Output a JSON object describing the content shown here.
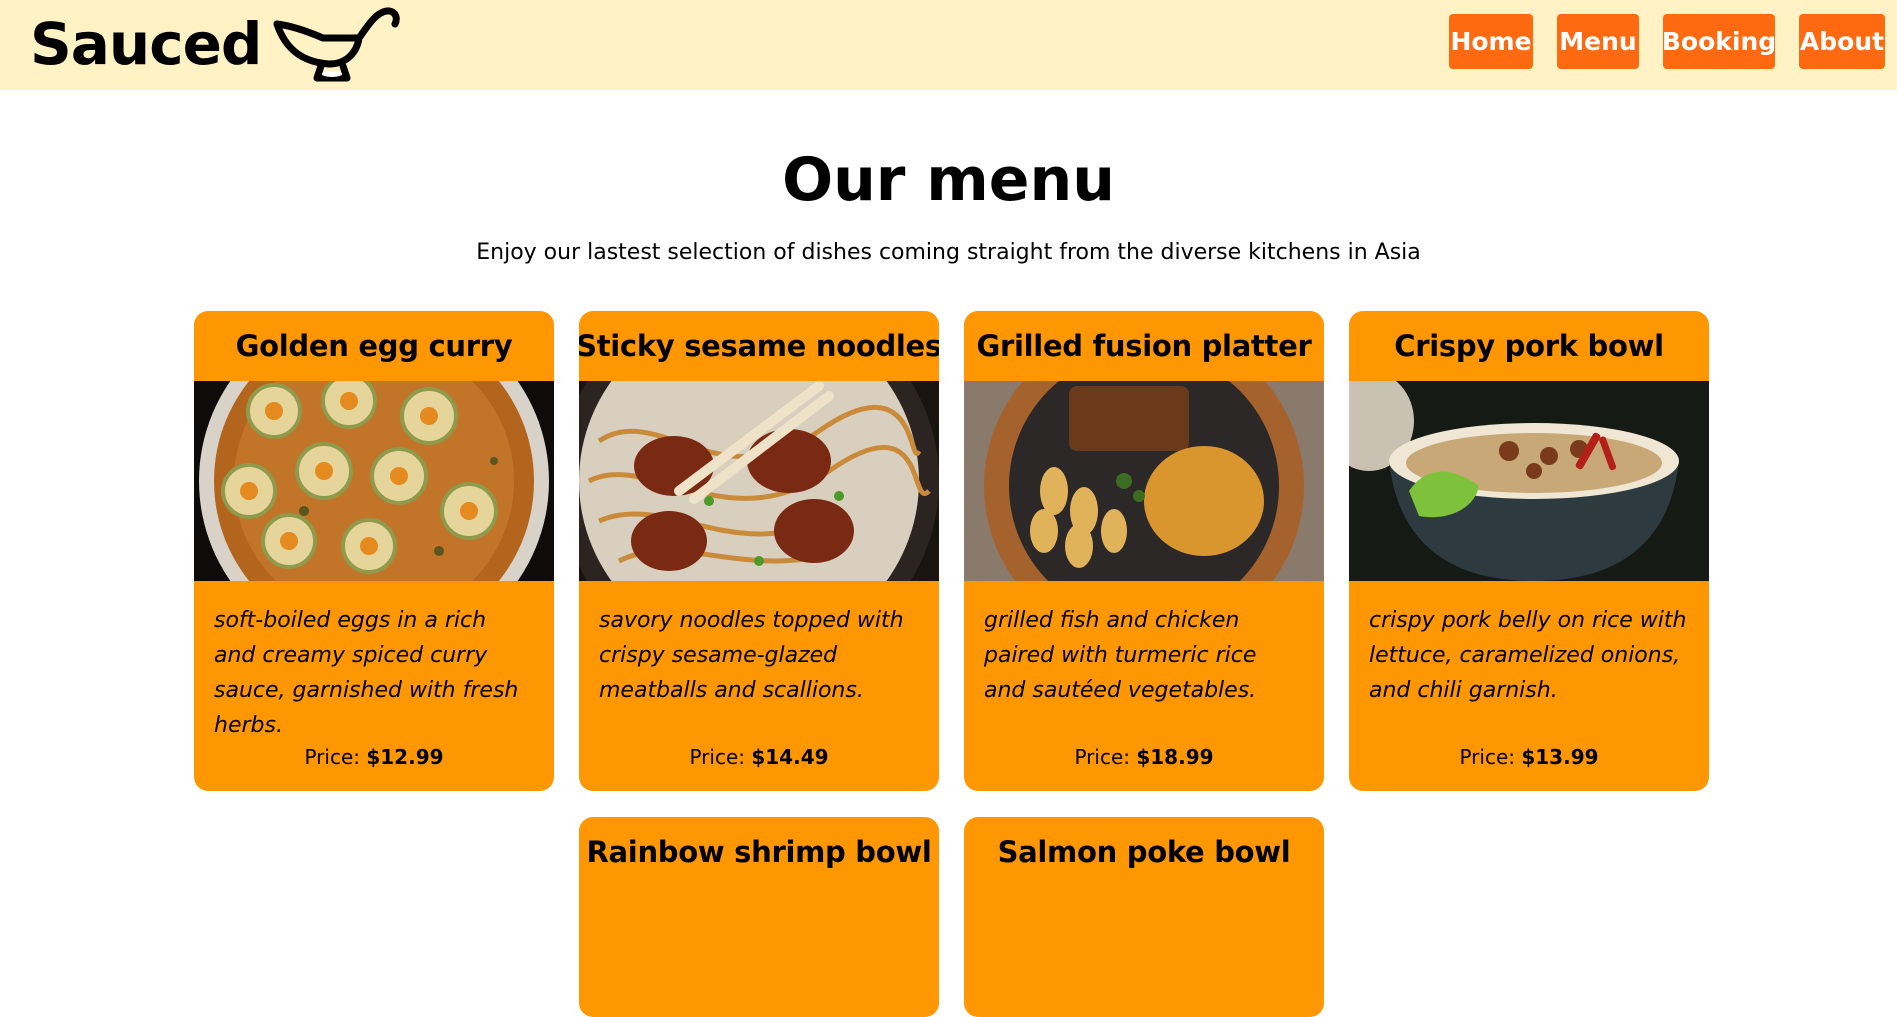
{
  "brand": {
    "name": "Sauced",
    "logo_icon": "gravy-boat-icon"
  },
  "nav": {
    "home": "Home",
    "menu": "Menu",
    "booking": "Booking",
    "about": "About"
  },
  "colors": {
    "topbar": "#fff2c4",
    "nav_button": "#ff6a10",
    "card": "#ff9702"
  },
  "page": {
    "title": "Our menu",
    "subtitle": "Enjoy our lastest selection of dishes coming straight from the diverse kitchens in Asia"
  },
  "price_label": "Price:",
  "dishes": [
    {
      "name": "Golden egg curry",
      "description": "soft-boiled eggs in a rich and creamy spiced curry sauce, garnished with fresh herbs.",
      "price": "$12.99",
      "image": "dumplings-in-curry-bowl"
    },
    {
      "name": "Sticky sesame noodles",
      "description": "savory noodles topped with crispy sesame-glazed meatballs and scallions.",
      "price": "$14.49",
      "image": "noodles-with-chopsticks"
    },
    {
      "name": "Grilled fusion platter",
      "description": "grilled fish and chicken paired with turmeric rice and sautéed vegetables.",
      "price": "$18.99",
      "image": "grilled-platter"
    },
    {
      "name": "Crispy pork bowl",
      "description": "crispy pork belly on rice with lettuce, caramelized onions, and chili garnish.",
      "price": "$13.99",
      "image": "pork-rice-bowl"
    },
    {
      "name": "Rainbow shrimp bowl"
    },
    {
      "name": "Salmon poke bowl"
    }
  ]
}
